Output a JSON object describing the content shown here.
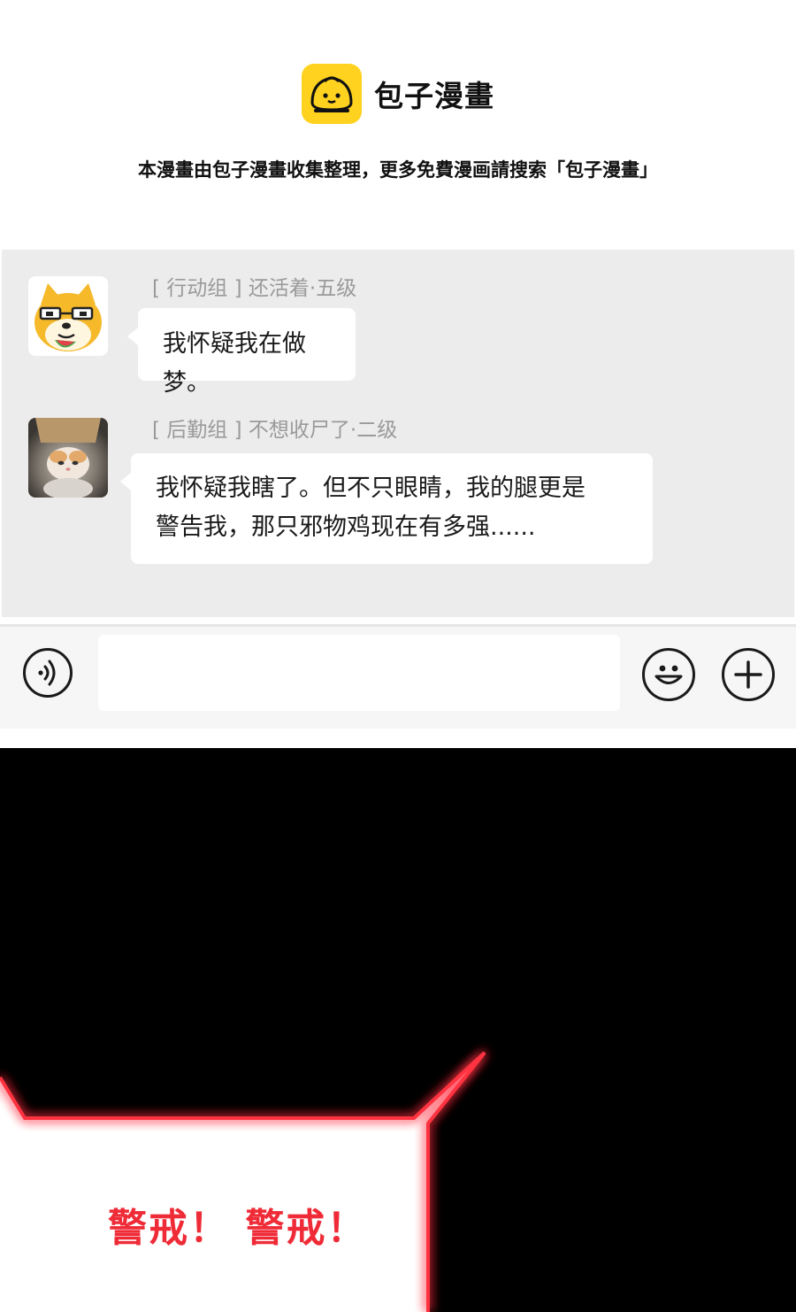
{
  "header": {
    "logo_text": "包子漫畫",
    "logo_icon": "steamed-bun-icon",
    "tagline": "本漫畫由包子漫畫收集整理，更多免費漫画請搜索「包子漫畫」",
    "brand_color": "#ffd21f"
  },
  "chat": {
    "messages": [
      {
        "sender": "[ 行动组 ] 还活着·五级",
        "text": "我怀疑我在做梦。",
        "avatar": "shiba-dog-avatar"
      },
      {
        "sender": "[ 后勤组 ] 不想收尸了·二级",
        "text_line1": "我怀疑我瞎了。但不只眼睛，我的腿更是",
        "text_line2": "警告我，那只邪物鸡现在有多强......",
        "avatar": "cat-photo-avatar"
      }
    ]
  },
  "input_bar": {
    "voice_icon": "voice-icon",
    "emoji_icon": "smiley-icon",
    "plus_icon": "plus-icon",
    "input_value": ""
  },
  "panel": {
    "alert_text": "警戒！ 警戒！",
    "alert_color": "#ef2b37",
    "glow_color": "#ff3040"
  }
}
